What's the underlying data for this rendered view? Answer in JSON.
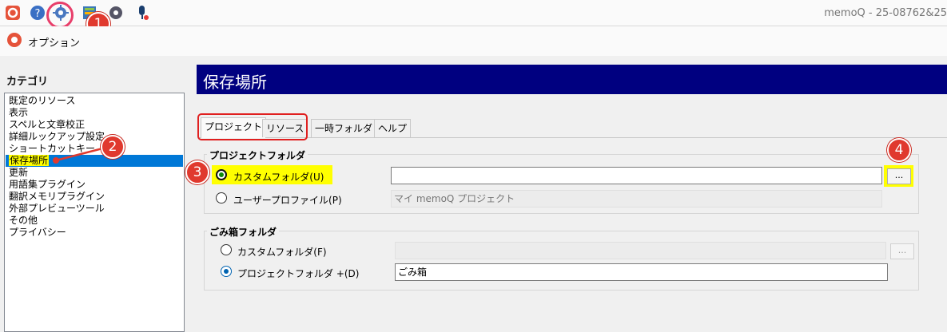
{
  "app": {
    "title": "memoQ - 25-08762&25"
  },
  "toolbar": {
    "icons": [
      "memoq-logo-icon",
      "help-icon",
      "options-gear-icon",
      "resource-console-icon",
      "settings-gear-icon",
      "microphone-icon"
    ]
  },
  "dialog": {
    "title": "オプション"
  },
  "categories": {
    "label": "カテゴリ",
    "items": [
      "既定のリソース",
      "表示",
      "スペルと文章校正",
      "詳細ルックアップ設定",
      "ショートカットキー",
      "保存場所",
      "更新",
      "用語集プラグイン",
      "翻訳メモリプラグイン",
      "外部プレビューツール",
      "その他",
      "プライバシー"
    ],
    "selected_index": 5
  },
  "header": {
    "title": "保存場所"
  },
  "tabs": [
    "プロジェクト",
    "リソース",
    "一時フォルダ",
    "ヘルプ"
  ],
  "project_folder": {
    "label": "プロジェクトフォルダ",
    "custom_label": "カスタムフォルダ(U)",
    "custom_value": "",
    "browse_label": "...",
    "profile_label": "ユーザープロファイル(P)",
    "profile_value": "マイ memoQ プロジェクト"
  },
  "trash_folder": {
    "label": "ごみ箱フォルダ",
    "custom_label": "カスタムフォルダ(F)",
    "custom_value": "",
    "browse_label": "...",
    "project_label": "プロジェクトフォルダ +(D)",
    "project_value": "ごみ箱"
  },
  "annotations": [
    "1",
    "2",
    "3",
    "4"
  ],
  "colors": {
    "header": "#000080",
    "selection": "#0078d7",
    "highlight": "#ffff00",
    "callout": "#e0392e"
  }
}
